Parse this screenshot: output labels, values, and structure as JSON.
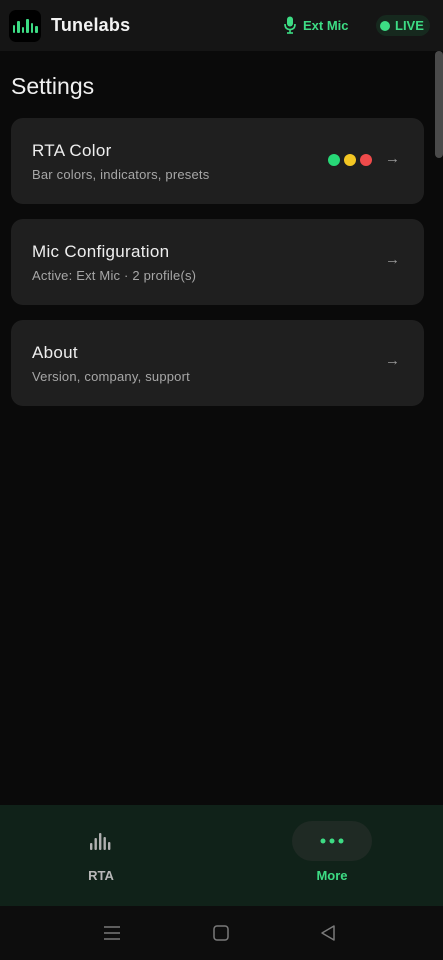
{
  "header": {
    "app_title": "Tunelabs",
    "mic_label": "Ext Mic",
    "live_label": "LIVE",
    "accent_color": "#3ddc84"
  },
  "settings": {
    "title": "Settings",
    "items": [
      {
        "title": "RTA Color",
        "subtitle": "Bar colors, indicators, presets",
        "arrow": "→",
        "swatches": [
          "#27d877",
          "#f3c623",
          "#ef4b4b"
        ]
      },
      {
        "title": "Mic Configuration",
        "subtitle": "Active: Ext Mic · 2 profile(s)",
        "arrow": "→"
      },
      {
        "title": "About",
        "subtitle": "Version, company, support",
        "arrow": "→"
      }
    ]
  },
  "bottom_nav": {
    "items": [
      {
        "label": "RTA",
        "icon": "rta-bars-icon",
        "active": false
      },
      {
        "label": "More",
        "icon": "more-dots-icon",
        "active": true
      }
    ]
  },
  "system_nav": {
    "icons": [
      "menu-icon",
      "home-icon",
      "back-icon"
    ]
  }
}
